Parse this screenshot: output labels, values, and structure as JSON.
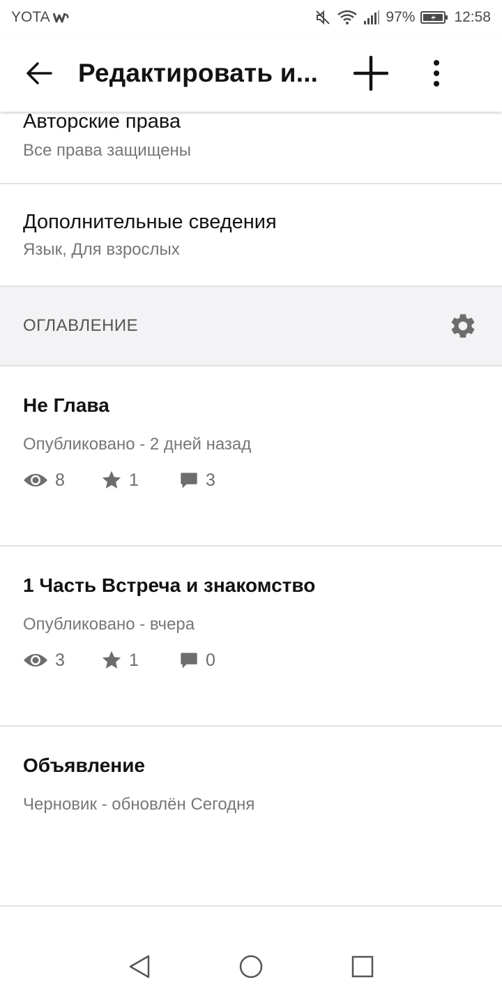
{
  "status_bar": {
    "carrier": "YOTA",
    "battery_percent": "97%",
    "time": "12:58"
  },
  "app_bar": {
    "title": "Редактировать и...",
    "icons": {
      "back": "arrow-left-icon",
      "add": "plus-icon",
      "more": "more-vertical-icon"
    }
  },
  "settings": {
    "copyright": {
      "title": "Авторские права",
      "subtitle": "Все права защищены"
    },
    "extra": {
      "title": "Дополнительные сведения",
      "subtitle": "Язык, Для взрослых"
    }
  },
  "toc": {
    "label": "ОГЛАВЛЕНИЕ",
    "parts": [
      {
        "title": "Не Глава",
        "status": "Опубликовано - 2 дней назад",
        "views": "8",
        "votes": "1",
        "comments": "3"
      },
      {
        "title": "1 Часть Встреча и знакомство",
        "status": "Опубликовано - вчера",
        "views": "3",
        "votes": "1",
        "comments": "0"
      },
      {
        "title": "Объявление",
        "status": "Черновик - обновлён Сегодня"
      }
    ]
  },
  "colors": {
    "text_primary": "#121212",
    "text_secondary": "#777777",
    "icon_gray": "#6d6d6d",
    "header_bg": "#f3f2f4",
    "divider": "#e2e2e2"
  }
}
